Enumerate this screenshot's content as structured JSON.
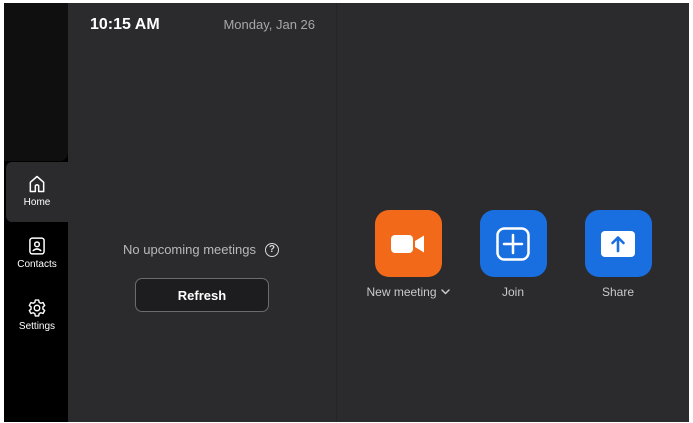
{
  "header": {
    "time": "10:15 AM",
    "date": "Monday, Jan 26"
  },
  "sidebar": {
    "items": [
      {
        "label": "Home",
        "icon": "home-icon",
        "active": true
      },
      {
        "label": "Contacts",
        "icon": "contacts-icon",
        "active": false
      },
      {
        "label": "Settings",
        "icon": "gear-icon",
        "active": false
      }
    ]
  },
  "meetings": {
    "empty_text": "No upcoming meetings",
    "help_icon": "help-icon",
    "refresh_label": "Refresh"
  },
  "actions": {
    "new_meeting": {
      "label": "New meeting",
      "icon": "video-camera-icon",
      "color": "#f26a19"
    },
    "join": {
      "label": "Join",
      "icon": "plus-icon",
      "color": "#1a6fe0"
    },
    "share": {
      "label": "Share",
      "icon": "share-up-arrow-icon",
      "color": "#1a6fe0"
    }
  },
  "colors": {
    "background": "#2b2b2d",
    "sidebar": "#000000",
    "accent_orange": "#f26a19",
    "accent_blue": "#1a6fe0"
  }
}
